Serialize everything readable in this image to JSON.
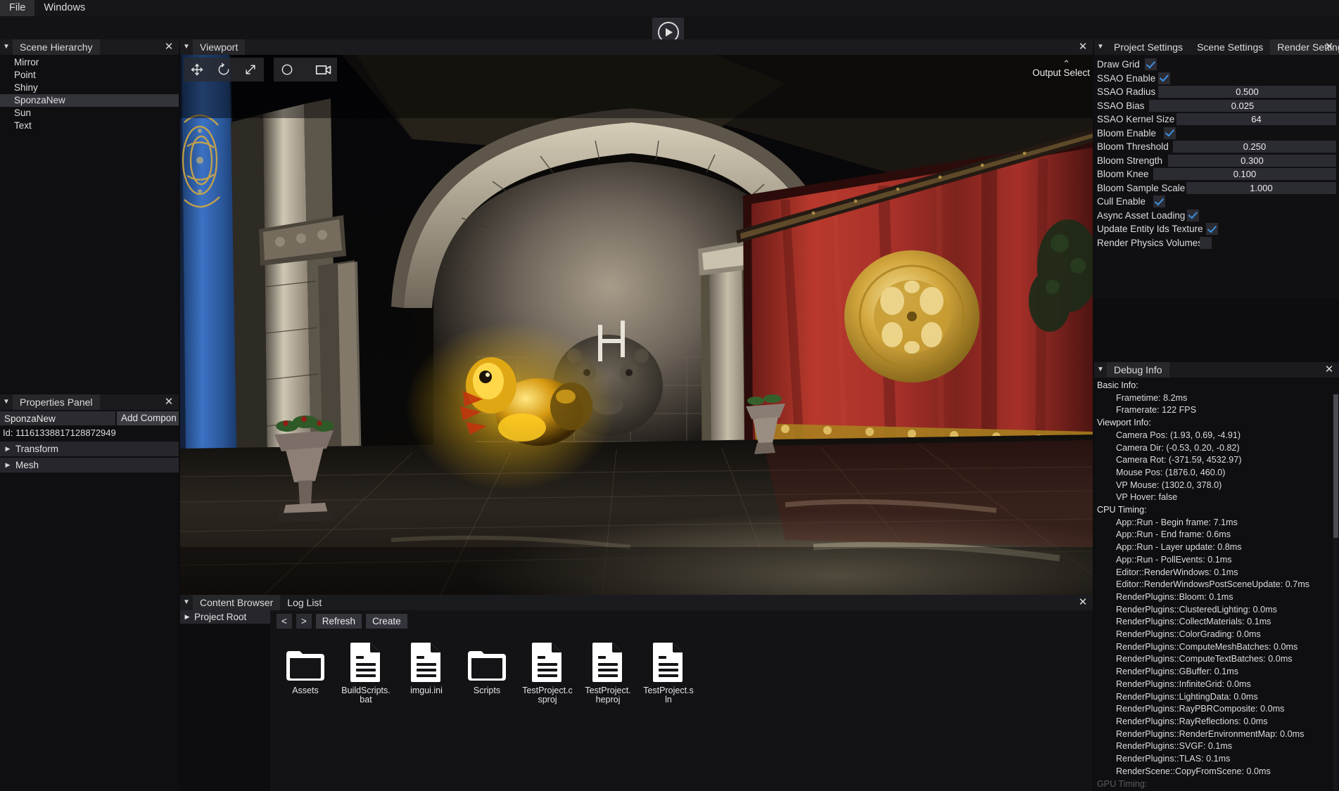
{
  "menubar": {
    "items": [
      "File",
      "Windows"
    ]
  },
  "toolbar": {
    "play_label": "play-button"
  },
  "scene_hierarchy": {
    "title": "Scene Hierarchy",
    "close": "✕",
    "caret": "▼",
    "items": [
      {
        "label": "Mirror",
        "selected": false
      },
      {
        "label": "Point",
        "selected": false
      },
      {
        "label": "Shiny",
        "selected": false
      },
      {
        "label": "SponzaNew",
        "selected": true
      },
      {
        "label": "Sun",
        "selected": false
      },
      {
        "label": "Text",
        "selected": false
      }
    ]
  },
  "properties_panel": {
    "title": "Properties Panel",
    "close": "✕",
    "caret": "▼",
    "entity_name": "SponzaNew",
    "add_component_label": "Add Compon",
    "id_text": "Id: 11161338817128872949",
    "components": [
      {
        "label": "Transform",
        "tri": "▶"
      },
      {
        "label": "Mesh",
        "tri": "▶"
      }
    ]
  },
  "viewport": {
    "title": "Viewport",
    "close": "✕",
    "caret": "▼",
    "tools": [
      {
        "name": "move-tool",
        "glyph": "move"
      },
      {
        "name": "rotate-tool",
        "glyph": "rotate"
      },
      {
        "name": "scale-tool",
        "glyph": "scale"
      },
      {
        "name": "select-circle-tool",
        "glyph": "circle"
      },
      {
        "name": "camera-tool",
        "glyph": "camera"
      }
    ],
    "output_select_label": "Output Select",
    "output_select_chevron": "⌃"
  },
  "content_browser": {
    "caret": "▼",
    "close": "✕",
    "tabs": [
      {
        "label": "Content Browser",
        "active": true
      },
      {
        "label": "Log List",
        "active": false
      }
    ],
    "tree_root": {
      "label": "Project Root",
      "tri": "▶"
    },
    "buttons": [
      {
        "label": "<",
        "name": "back-button",
        "arrow": true
      },
      {
        "label": ">",
        "name": "forward-button",
        "arrow": true
      },
      {
        "label": "Refresh",
        "name": "refresh-button",
        "arrow": false
      },
      {
        "label": "Create",
        "name": "create-button",
        "arrow": false
      }
    ],
    "files": [
      {
        "label": "Assets",
        "type": "folder"
      },
      {
        "label": "BuildScripts.bat",
        "type": "file"
      },
      {
        "label": "imgui.ini",
        "type": "file"
      },
      {
        "label": "Scripts",
        "type": "folder"
      },
      {
        "label": "TestProject.csproj",
        "type": "file"
      },
      {
        "label": "TestProject.heproj",
        "type": "file"
      },
      {
        "label": "TestProject.sln",
        "type": "file"
      }
    ]
  },
  "settings_panel": {
    "caret": "▼",
    "close": "✕",
    "tabs": [
      {
        "label": "Project Settings",
        "active": false
      },
      {
        "label": "Scene Settings",
        "active": false
      },
      {
        "label": "Render Settings",
        "active": true
      }
    ],
    "rows": [
      {
        "label": "Draw Grid",
        "type": "checkbox",
        "checked": true,
        "labelw": 68
      },
      {
        "label": "SSAO Enable",
        "type": "checkbox",
        "checked": true,
        "labelw": 87
      },
      {
        "label": "SSAO Radius",
        "type": "slider",
        "value": "0.500",
        "labelw": 87
      },
      {
        "label": "SSAO Bias",
        "type": "slider",
        "value": "0.025",
        "labelw": 74
      },
      {
        "label": "SSAO Kernel Size",
        "type": "slider",
        "value": "64",
        "labelw": 113
      },
      {
        "label": "Bloom Enable",
        "type": "checkbox",
        "checked": true,
        "labelw": 95
      },
      {
        "label": "Bloom Threshold",
        "type": "slider",
        "value": "0.250",
        "labelw": 108
      },
      {
        "label": "Bloom Strength",
        "type": "slider",
        "value": "0.300",
        "labelw": 101
      },
      {
        "label": "Bloom Knee",
        "type": "slider",
        "value": "0.100",
        "labelw": 80
      },
      {
        "label": "Bloom Sample Scale",
        "type": "slider",
        "value": "1.000",
        "labelw": 127
      },
      {
        "label": "Cull Enable",
        "type": "checkbox",
        "checked": true,
        "labelw": 80
      },
      {
        "label": "Async Asset Loading",
        "type": "checkbox",
        "checked": true,
        "labelw": 128
      },
      {
        "label": "Update Entity Ids Texture",
        "type": "checkbox",
        "checked": true,
        "labelw": 155
      },
      {
        "label": "Render Physics Volumes",
        "type": "checkbox",
        "checked": false,
        "labelw": 146
      }
    ]
  },
  "debug_info": {
    "title": "Debug Info",
    "caret": "▼",
    "close": "✕",
    "lines": [
      {
        "text": "Basic Info:",
        "indent": 0
      },
      {
        "text": "Frametime: 8.2ms",
        "indent": 1
      },
      {
        "text": "Framerate: 122 FPS",
        "indent": 1
      },
      {
        "text": "Viewport Info:",
        "indent": 0
      },
      {
        "text": "Camera Pos: (1.93, 0.69, -4.91)",
        "indent": 1
      },
      {
        "text": "Camera Dir: (-0.53, 0.20, -0.82)",
        "indent": 1
      },
      {
        "text": "Camera Rot: (-371.59, 4532.97)",
        "indent": 1
      },
      {
        "text": "Mouse Pos: (1876.0, 460.0)",
        "indent": 1
      },
      {
        "text": "VP Mouse: (1302.0, 378.0)",
        "indent": 1
      },
      {
        "text": "VP Hover: false",
        "indent": 1
      },
      {
        "text": "CPU Timing:",
        "indent": 0
      },
      {
        "text": "App::Run - Begin frame: 7.1ms",
        "indent": 1
      },
      {
        "text": "App::Run - End frame: 0.6ms",
        "indent": 1
      },
      {
        "text": "App::Run - Layer update: 0.8ms",
        "indent": 1
      },
      {
        "text": "App::Run - PollEvents: 0.1ms",
        "indent": 1
      },
      {
        "text": "Editor::RenderWindows: 0.1ms",
        "indent": 1
      },
      {
        "text": "Editor::RenderWindowsPostSceneUpdate: 0.7ms",
        "indent": 1
      },
      {
        "text": "RenderPlugins::Bloom: 0.1ms",
        "indent": 1
      },
      {
        "text": "RenderPlugins::ClusteredLighting: 0.0ms",
        "indent": 1
      },
      {
        "text": "RenderPlugins::CollectMaterials: 0.1ms",
        "indent": 1
      },
      {
        "text": "RenderPlugins::ColorGrading: 0.0ms",
        "indent": 1
      },
      {
        "text": "RenderPlugins::ComputeMeshBatches: 0.0ms",
        "indent": 1
      },
      {
        "text": "RenderPlugins::ComputeTextBatches: 0.0ms",
        "indent": 1
      },
      {
        "text": "RenderPlugins::GBuffer: 0.1ms",
        "indent": 1
      },
      {
        "text": "RenderPlugins::InfiniteGrid: 0.0ms",
        "indent": 1
      },
      {
        "text": "RenderPlugins::LightingData: 0.0ms",
        "indent": 1
      },
      {
        "text": "RenderPlugins::RayPBRComposite: 0.0ms",
        "indent": 1
      },
      {
        "text": "RenderPlugins::RayReflections: 0.0ms",
        "indent": 1
      },
      {
        "text": "RenderPlugins::RenderEnvironmentMap: 0.0ms",
        "indent": 1
      },
      {
        "text": "RenderPlugins::SVGF: 0.1ms",
        "indent": 1
      },
      {
        "text": "RenderPlugins::TLAS: 0.1ms",
        "indent": 1
      },
      {
        "text": "RenderScene::CopyFromScene: 0.0ms",
        "indent": 1
      },
      {
        "text": "GPU Timing:",
        "indent": 0,
        "clipped": true
      }
    ]
  },
  "colors": {
    "accent_blue": "#3d8fe0",
    "panel_bg": "#121215",
    "panel_header": "#1b1b1f",
    "selection": "#33333a",
    "curtain_red": "#a8342c",
    "banner_blue": "#2f62ad",
    "gold": "#d9a93a"
  }
}
